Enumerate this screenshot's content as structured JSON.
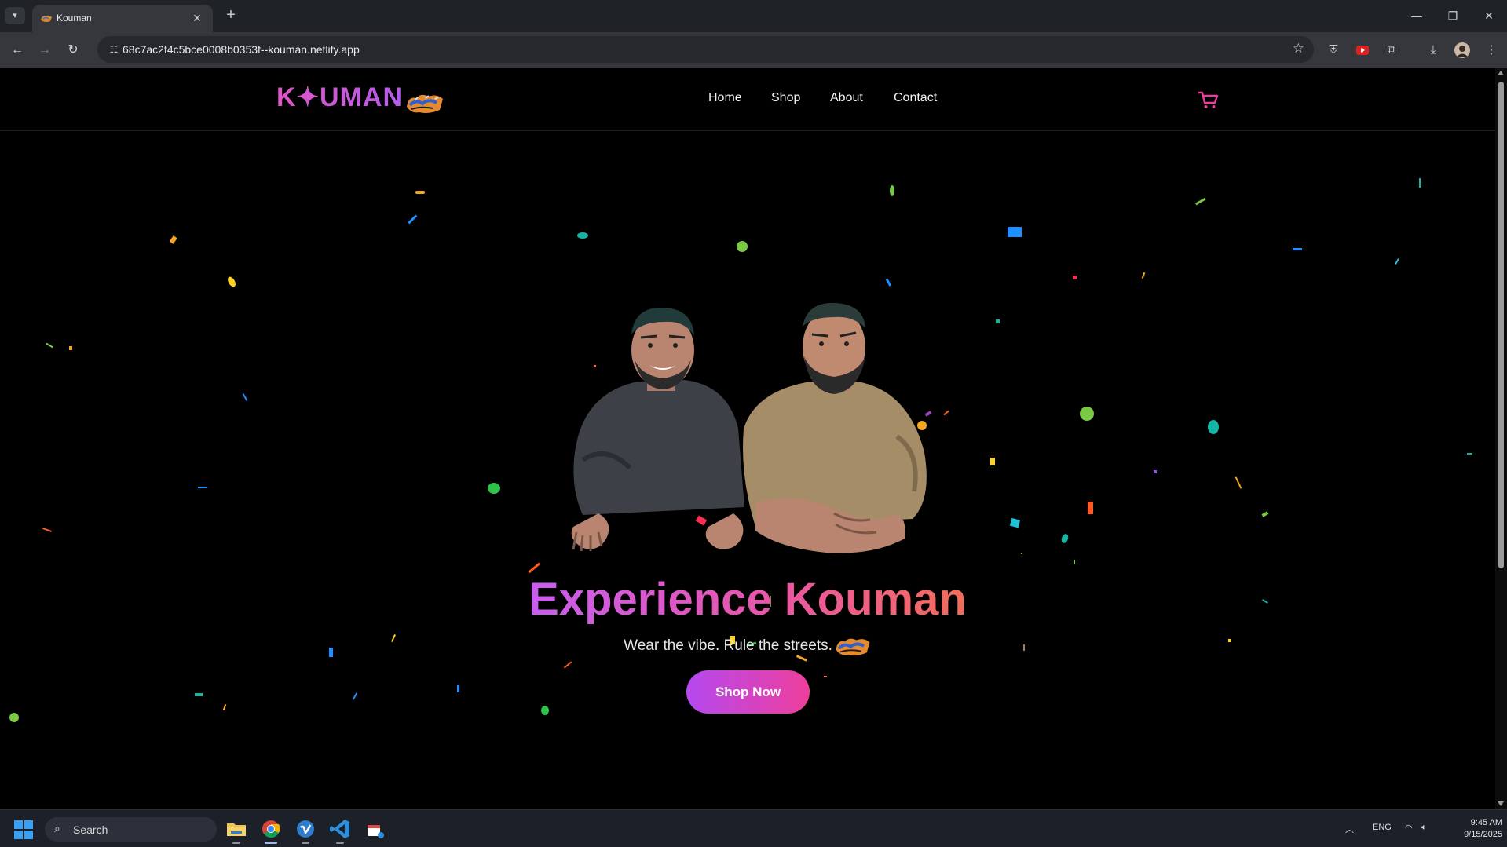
{
  "browser": {
    "tab_title": "Kouman",
    "url": "68c7ac2f4c5bce0008b0353f--kouman.netlify.app"
  },
  "site": {
    "logo_text": "K✦UMAN",
    "nav": [
      "Home",
      "Shop",
      "About",
      "Contact"
    ],
    "hero_title": "Experience Kouman",
    "hero_subtitle": "Wear the vibe. Rule the streets.",
    "cta_label": "Shop Now",
    "accent_colors": [
      "#b549f0",
      "#ee3e9b",
      "#f26d5a"
    ]
  },
  "taskbar": {
    "search_placeholder": "Search",
    "language": "ENG",
    "time": "9:45 AM",
    "date": "9/15/2025"
  }
}
